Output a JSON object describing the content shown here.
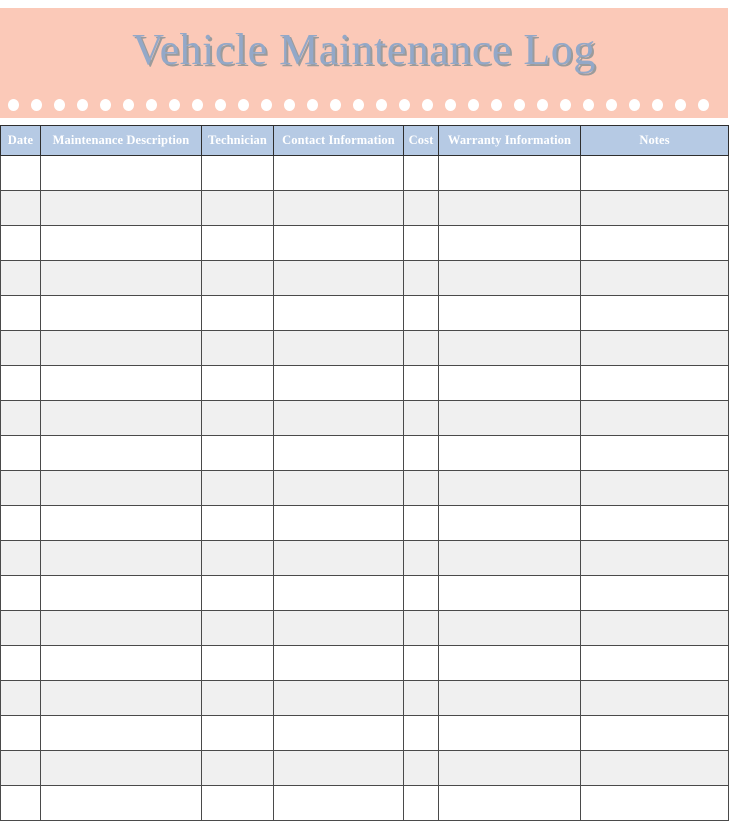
{
  "document": {
    "title": "Vehicle Maintenance Log"
  },
  "banner": {
    "background_color": "#fbc9b8",
    "title": "Vehicle Maintenance Log",
    "title_color": "#93a8c8",
    "title_shadow_color": "#9b9b9b",
    "dot_color": "#ffffff",
    "dot_count": 31
  },
  "table": {
    "header_background_color": "#b6cae4",
    "header_text_color": "#ffffff",
    "stripe_color": "#f0f0f0",
    "border_color": "#3a3a3a",
    "columns": [
      {
        "key": "date",
        "label": "Date"
      },
      {
        "key": "desc",
        "label": "Maintenance Description"
      },
      {
        "key": "tech",
        "label": "Technician"
      },
      {
        "key": "contact",
        "label": "Contact Information"
      },
      {
        "key": "cost",
        "label": "Cost"
      },
      {
        "key": "warranty",
        "label": "Warranty Information"
      },
      {
        "key": "notes",
        "label": "Notes"
      }
    ],
    "row_count": 19,
    "rows": [
      {
        "date": "",
        "desc": "",
        "tech": "",
        "contact": "",
        "cost": "",
        "warranty": "",
        "notes": ""
      },
      {
        "date": "",
        "desc": "",
        "tech": "",
        "contact": "",
        "cost": "",
        "warranty": "",
        "notes": ""
      },
      {
        "date": "",
        "desc": "",
        "tech": "",
        "contact": "",
        "cost": "",
        "warranty": "",
        "notes": ""
      },
      {
        "date": "",
        "desc": "",
        "tech": "",
        "contact": "",
        "cost": "",
        "warranty": "",
        "notes": ""
      },
      {
        "date": "",
        "desc": "",
        "tech": "",
        "contact": "",
        "cost": "",
        "warranty": "",
        "notes": ""
      },
      {
        "date": "",
        "desc": "",
        "tech": "",
        "contact": "",
        "cost": "",
        "warranty": "",
        "notes": ""
      },
      {
        "date": "",
        "desc": "",
        "tech": "",
        "contact": "",
        "cost": "",
        "warranty": "",
        "notes": ""
      },
      {
        "date": "",
        "desc": "",
        "tech": "",
        "contact": "",
        "cost": "",
        "warranty": "",
        "notes": ""
      },
      {
        "date": "",
        "desc": "",
        "tech": "",
        "contact": "",
        "cost": "",
        "warranty": "",
        "notes": ""
      },
      {
        "date": "",
        "desc": "",
        "tech": "",
        "contact": "",
        "cost": "",
        "warranty": "",
        "notes": ""
      },
      {
        "date": "",
        "desc": "",
        "tech": "",
        "contact": "",
        "cost": "",
        "warranty": "",
        "notes": ""
      },
      {
        "date": "",
        "desc": "",
        "tech": "",
        "contact": "",
        "cost": "",
        "warranty": "",
        "notes": ""
      },
      {
        "date": "",
        "desc": "",
        "tech": "",
        "contact": "",
        "cost": "",
        "warranty": "",
        "notes": ""
      },
      {
        "date": "",
        "desc": "",
        "tech": "",
        "contact": "",
        "cost": "",
        "warranty": "",
        "notes": ""
      },
      {
        "date": "",
        "desc": "",
        "tech": "",
        "contact": "",
        "cost": "",
        "warranty": "",
        "notes": ""
      },
      {
        "date": "",
        "desc": "",
        "tech": "",
        "contact": "",
        "cost": "",
        "warranty": "",
        "notes": ""
      },
      {
        "date": "",
        "desc": "",
        "tech": "",
        "contact": "",
        "cost": "",
        "warranty": "",
        "notes": ""
      },
      {
        "date": "",
        "desc": "",
        "tech": "",
        "contact": "",
        "cost": "",
        "warranty": "",
        "notes": ""
      },
      {
        "date": "",
        "desc": "",
        "tech": "",
        "contact": "",
        "cost": "",
        "warranty": "",
        "notes": ""
      }
    ]
  }
}
